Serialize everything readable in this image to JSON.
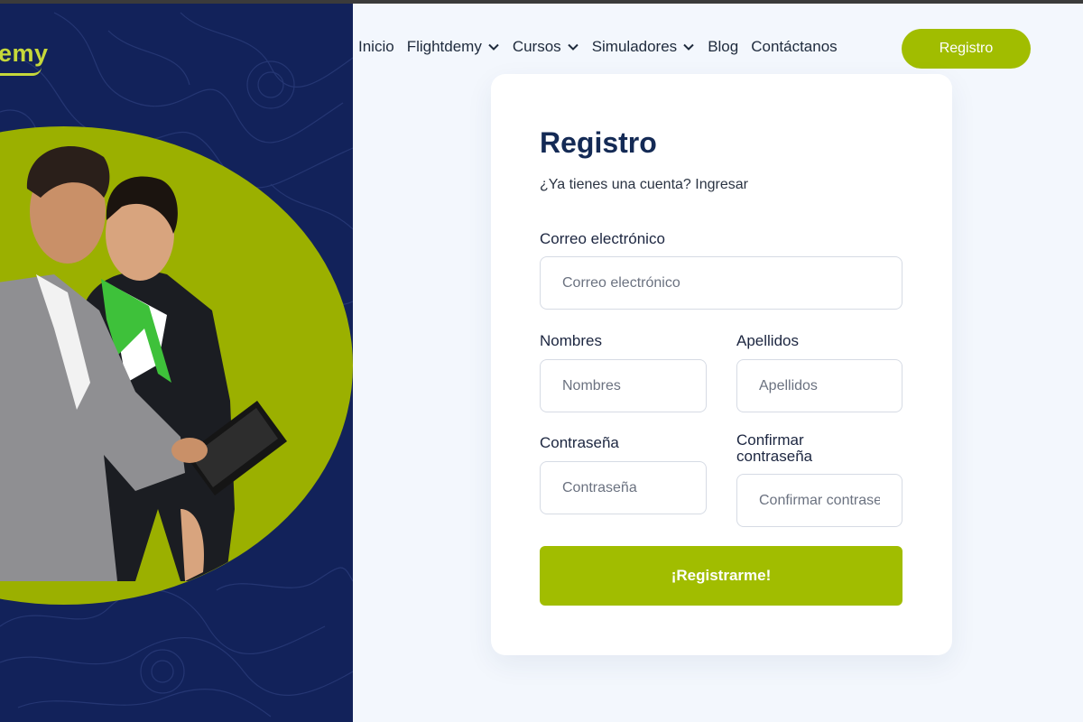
{
  "brand": {
    "logo_text": "emy"
  },
  "nav": {
    "items": [
      {
        "label": "Inicio",
        "dropdown": false
      },
      {
        "label": "Flightdemy",
        "dropdown": true
      },
      {
        "label": "Cursos",
        "dropdown": true
      },
      {
        "label": "Simuladores",
        "dropdown": true
      },
      {
        "label": "Blog",
        "dropdown": false
      },
      {
        "label": "Contáctanos",
        "dropdown": false
      }
    ],
    "register_button": "Registro"
  },
  "form": {
    "title": "Registro",
    "subtitle_prefix": "¿Ya tienes una cuenta?",
    "subtitle_link": "Ingresar",
    "email": {
      "label": "Correo electrónico",
      "placeholder": "Correo electrónico",
      "value": ""
    },
    "first_name": {
      "label": "Nombres",
      "placeholder": "Nombres",
      "value": ""
    },
    "last_name": {
      "label": "Apellidos",
      "placeholder": "Apellidos",
      "value": ""
    },
    "password": {
      "label": "Contraseña",
      "placeholder": "Contraseña",
      "value": ""
    },
    "confirm_password": {
      "label_line1": "Confirmar",
      "label_line2": "contraseña",
      "placeholder": "Confirmar contraseña",
      "value": ""
    },
    "submit_label": "¡Registrarme!"
  },
  "colors": {
    "accent_green": "#a1bd00",
    "hero_navy": "#12225a",
    "title_navy": "#142a55",
    "page_bg": "#f3f7fd"
  }
}
